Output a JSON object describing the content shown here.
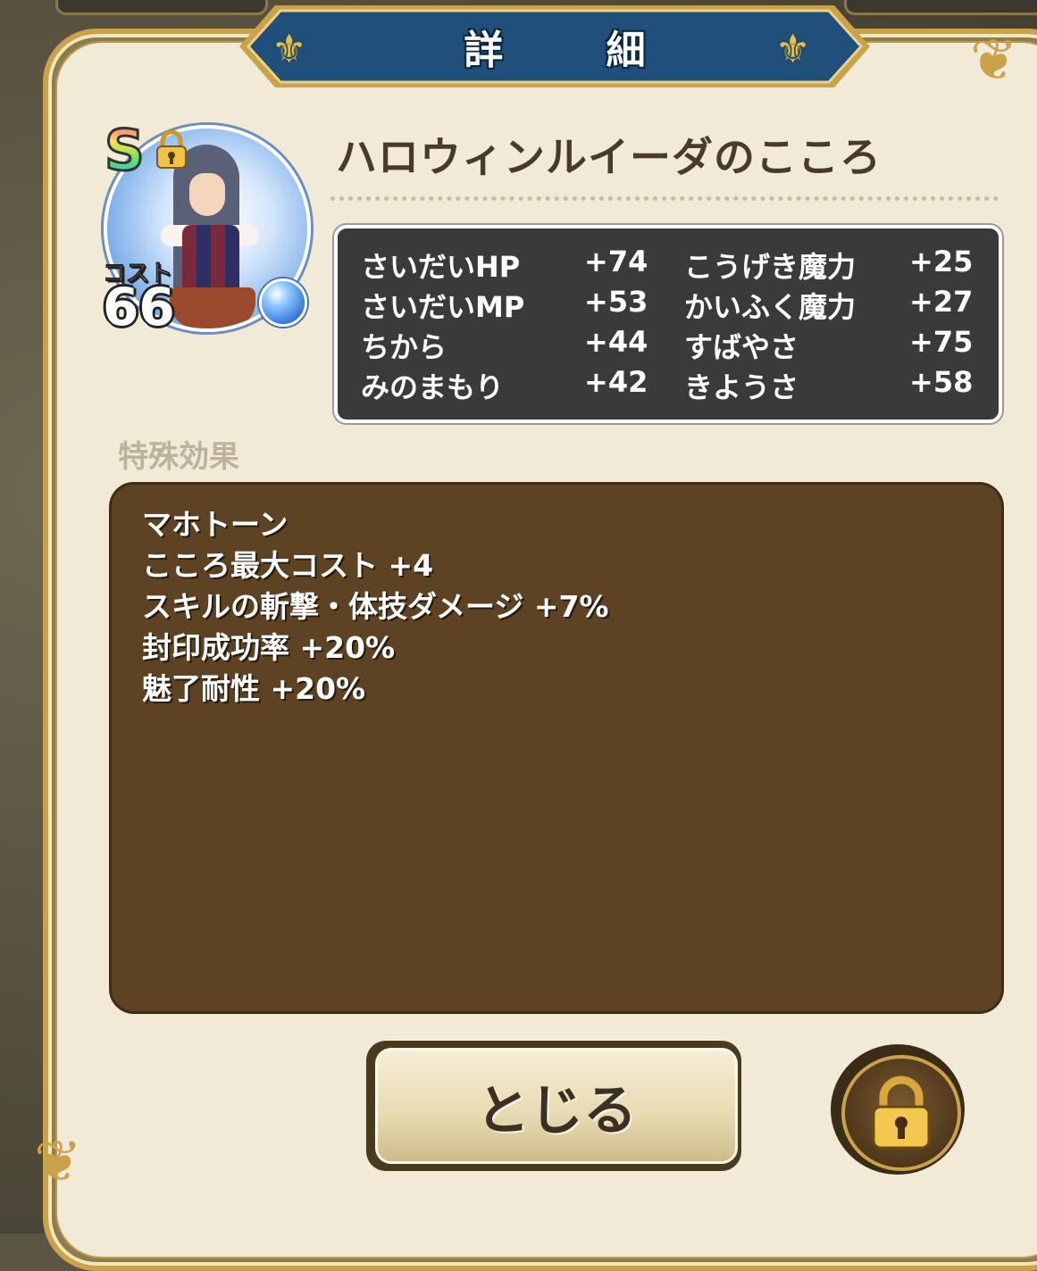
{
  "header": {
    "title": "詳 細"
  },
  "heart": {
    "rank": "S",
    "cost_label": "コスト",
    "cost_value": "66",
    "name": "ハロウィンルイーダのこころ"
  },
  "stats": [
    {
      "name1": "さいだいHP",
      "value1": "+74",
      "name2": "こうげき魔力",
      "value2": "+25"
    },
    {
      "name1": "さいだいMP",
      "value1": "+53",
      "name2": "かいふく魔力",
      "value2": "+27"
    },
    {
      "name1": "ちから",
      "value1": "+44",
      "name2": "すばやさ",
      "value2": "+75"
    },
    {
      "name1": "みのまもり",
      "value1": "+42",
      "name2": "きようさ",
      "value2": "+58"
    }
  ],
  "effects": {
    "title": "特殊効果",
    "lines": [
      "マホトーン",
      "こころ最大コスト +4",
      "スキルの斬撃・体技ダメージ +7%",
      "封印成功率 +20%",
      "魅了耐性 +20%"
    ]
  },
  "buttons": {
    "close_label": "とじる",
    "lock_icon": "padlock-icon"
  },
  "colors": {
    "header_blue": "#1f4f7a",
    "gold_trim": "#c9a24a",
    "effect_panel": "#5d4323",
    "stats_panel": "#3a3a3a"
  }
}
